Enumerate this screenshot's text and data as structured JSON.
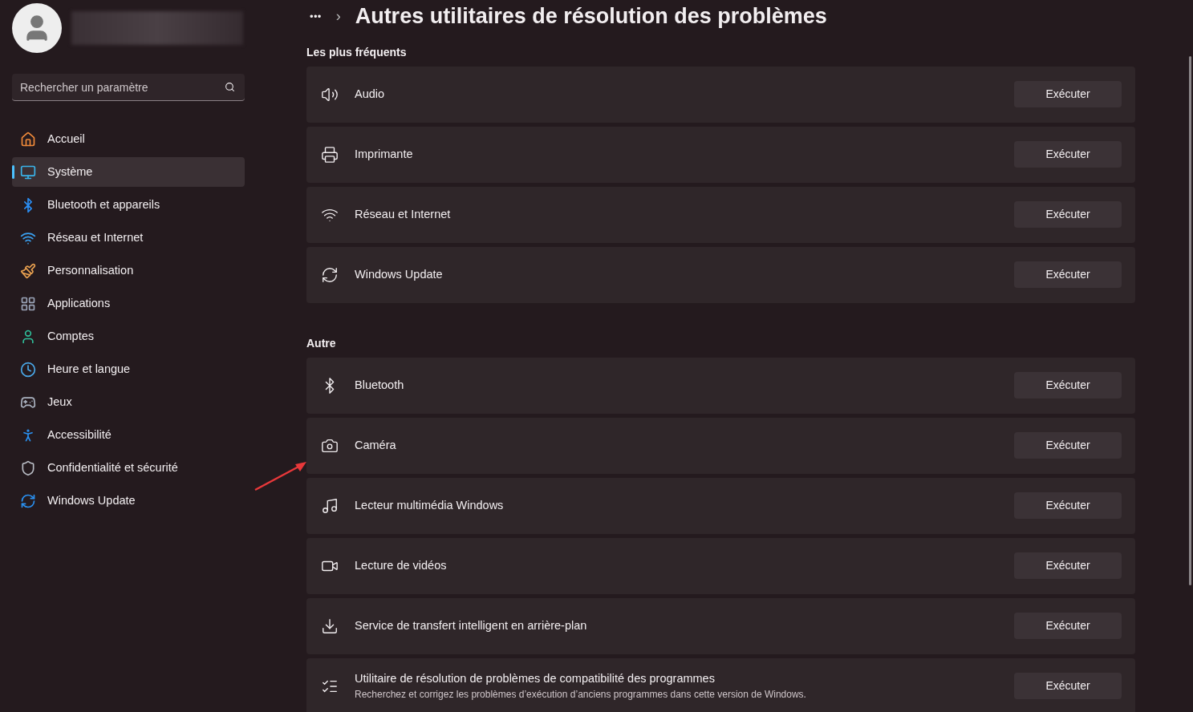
{
  "search": {
    "placeholder": "Rechercher un paramètre"
  },
  "sidebar": {
    "items": [
      {
        "label": "Accueil",
        "selected": false
      },
      {
        "label": "Système",
        "selected": true
      },
      {
        "label": "Bluetooth et appareils",
        "selected": false
      },
      {
        "label": "Réseau et Internet",
        "selected": false
      },
      {
        "label": "Personnalisation",
        "selected": false
      },
      {
        "label": "Applications",
        "selected": false
      },
      {
        "label": "Comptes",
        "selected": false
      },
      {
        "label": "Heure et langue",
        "selected": false
      },
      {
        "label": "Jeux",
        "selected": false
      },
      {
        "label": "Accessibilité",
        "selected": false
      },
      {
        "label": "Confidentialité et sécurité",
        "selected": false
      },
      {
        "label": "Windows Update",
        "selected": false
      }
    ]
  },
  "breadcrumb": {
    "more": "•••",
    "separator": "›",
    "title": "Autres utilitaires de résolution des problèmes"
  },
  "sections": [
    {
      "title": "Les plus fréquents",
      "rows": [
        {
          "label": "Audio",
          "button": "Exécuter"
        },
        {
          "label": "Imprimante",
          "button": "Exécuter"
        },
        {
          "label": "Réseau et Internet",
          "button": "Exécuter"
        },
        {
          "label": "Windows Update",
          "button": "Exécuter"
        }
      ]
    },
    {
      "title": "Autre",
      "rows": [
        {
          "label": "Bluetooth",
          "button": "Exécuter"
        },
        {
          "label": "Caméra",
          "button": "Exécuter"
        },
        {
          "label": "Lecteur multimédia Windows",
          "button": "Exécuter"
        },
        {
          "label": "Lecture de vidéos",
          "button": "Exécuter"
        },
        {
          "label": "Service de transfert intelligent en arrière-plan",
          "button": "Exécuter"
        },
        {
          "label": "Utilitaire de résolution de problèmes de compatibilité des programmes",
          "description": "Recherchez et corrigez les problèmes d’exécution d’anciens programmes dans cette version de Windows.",
          "button": "Exécuter"
        }
      ]
    }
  ]
}
